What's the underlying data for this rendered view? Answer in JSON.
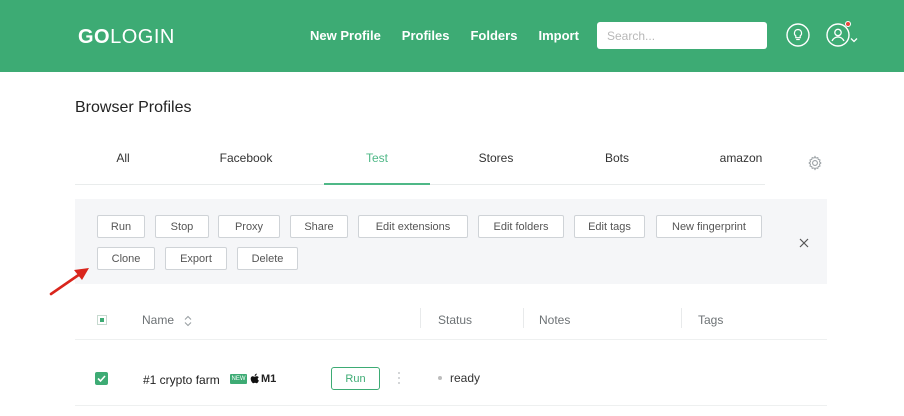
{
  "header": {
    "logo_prefix": "GO",
    "logo_suffix": "LOGIN",
    "nav": [
      "New Profile",
      "Profiles",
      "Folders",
      "Import"
    ],
    "search_placeholder": "Search...",
    "accent_color": "#3dab74"
  },
  "page": {
    "title": "Browser Profiles"
  },
  "tabs": {
    "items": [
      "All",
      "Facebook",
      "Test",
      "Stores",
      "Bots",
      "amazon"
    ],
    "active": "Test"
  },
  "actions": {
    "row1": [
      "Run",
      "Stop",
      "Proxy",
      "Share",
      "Edit extensions",
      "Edit folders",
      "Edit tags",
      "New fingerprint"
    ],
    "row2": [
      "Clone",
      "Export",
      "Delete"
    ],
    "close": "×"
  },
  "table": {
    "columns": {
      "name": "Name",
      "status": "Status",
      "notes": "Notes",
      "tags": "Tags"
    },
    "rows": [
      {
        "name": "#1 crypto farm",
        "badge": "NEW",
        "os": "M1",
        "run_label": "Run",
        "status": "ready",
        "checked": true
      }
    ]
  },
  "icons": [
    "lightbulb-icon",
    "user-icon",
    "chevron-down-icon",
    "gear-icon",
    "close-icon",
    "sort-icon",
    "apple-icon",
    "kebab-icon",
    "arrow-icon"
  ]
}
